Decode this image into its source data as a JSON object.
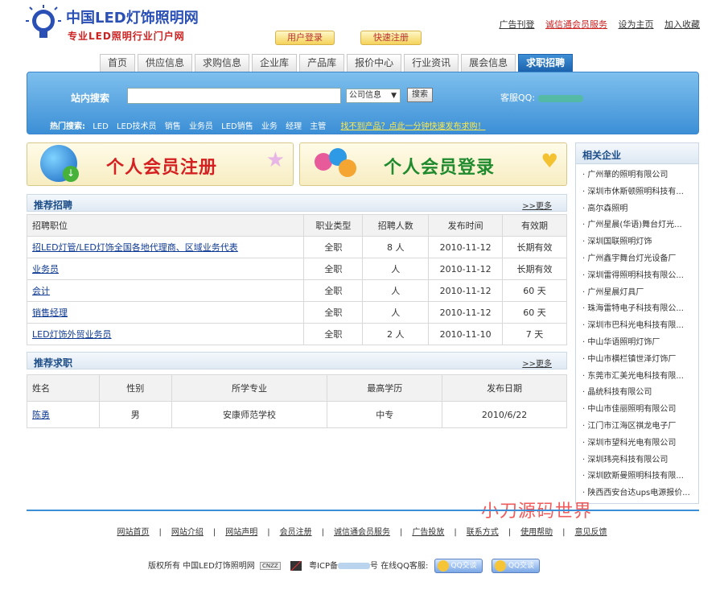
{
  "logo": {
    "title": "中国LED灯饰照明网",
    "subtitle": "专业LED照明行业门户网"
  },
  "top_links": [
    "广告刊登",
    "诚信通会员服务",
    "设为主页",
    "加入收藏"
  ],
  "auth": {
    "login": "用户登录",
    "register": "快速注册"
  },
  "nav": [
    "首页",
    "供应信息",
    "求购信息",
    "企业库",
    "产品库",
    "报价中心",
    "行业资讯",
    "展会信息",
    "求职招聘"
  ],
  "search": {
    "label": "站内搜索",
    "input_value": "",
    "select_value": "公司信息",
    "button": "搜索",
    "kefu_label": "客服QQ:",
    "hot_label": "热门搜索:",
    "hot_keywords": [
      "LED",
      "LED技术员",
      "销售",
      "业务员",
      "LED销售",
      "业务",
      "经理",
      "主管"
    ],
    "promo": "找不到产品？点此一分钟快速发布求购！"
  },
  "banners": {
    "register": "个人会员注册",
    "login": "个人会员登录"
  },
  "jobs": {
    "title": "推荐招聘",
    "more": ">>更多",
    "headers": [
      "招聘职位",
      "职业类型",
      "招聘人数",
      "发布时间",
      "有效期"
    ],
    "rows": [
      [
        "招LED灯管/LED灯饰全国各地代理商、区域业务代表",
        "全职",
        "8 人",
        "2010-11-12",
        "长期有效"
      ],
      [
        "业务员",
        "全职",
        "人",
        "2010-11-12",
        "长期有效"
      ],
      [
        "会计",
        "全职",
        "人",
        "2010-11-12",
        "60 天"
      ],
      [
        "销售经理",
        "全职",
        "人",
        "2010-11-12",
        "60 天"
      ],
      [
        "LED灯饰外贸业务员",
        "全职",
        "2 人",
        "2010-11-10",
        "7 天"
      ]
    ]
  },
  "seekers": {
    "title": "推荐求职",
    "more": ">>更多",
    "headers": [
      "姓名",
      "性别",
      "所学专业",
      "最高学历",
      "发布日期"
    ],
    "rows": [
      [
        "陈勇",
        "男",
        "安康师范学校",
        "中专",
        "2010/6/22"
      ]
    ]
  },
  "sidebar": {
    "title": "相关企业",
    "items": [
      "广州華的照明有限公司",
      "深圳市休斯顿照明科技有...",
      "高尔森照明",
      "广州星晨(华语)舞台灯光...",
      "深圳国联照明灯饰",
      "广州鑫宇舞台灯光设备厂",
      "深圳雷得照明科技有限公...",
      "广州星晨灯具厂",
      "珠海雷特电子科技有限公...",
      "深圳市巴科光电科技有限...",
      "中山华语照明灯饰厂",
      "中山市横栏镇世泽灯饰厂",
      "东莞市汇美光电科技有限...",
      "晶统科技有限公司",
      "中山市佳丽照明有限公司",
      "江门市江海区祺龙电子厂",
      "深圳市望科光电有限公司",
      "深圳玮亮科技有限公司",
      "深圳欧斯曼照明科技有限...",
      "陕西西安台达ups电源报价..."
    ]
  },
  "footer": {
    "links": [
      "网站首页",
      "网站介绍",
      "网站声明",
      "会员注册",
      "诚信通会员服务",
      "广告投放",
      "联系方式",
      "使用帮助",
      "意见反馈"
    ],
    "copyright_prefix": "版权所有 中国LED灯饰照明网",
    "badge": "CNZZ",
    "icp_prefix": "粤ICP备",
    "icp_suffix": "号 在线QQ客服:",
    "qq_label": "QQ交谈"
  },
  "watermark": "小刀源码世界",
  "colors": {
    "brand_blue": "#2a4fb5",
    "accent_red": "#d42020",
    "nav_active": "#1c62ac",
    "search_bar": "#3c8fd6"
  }
}
